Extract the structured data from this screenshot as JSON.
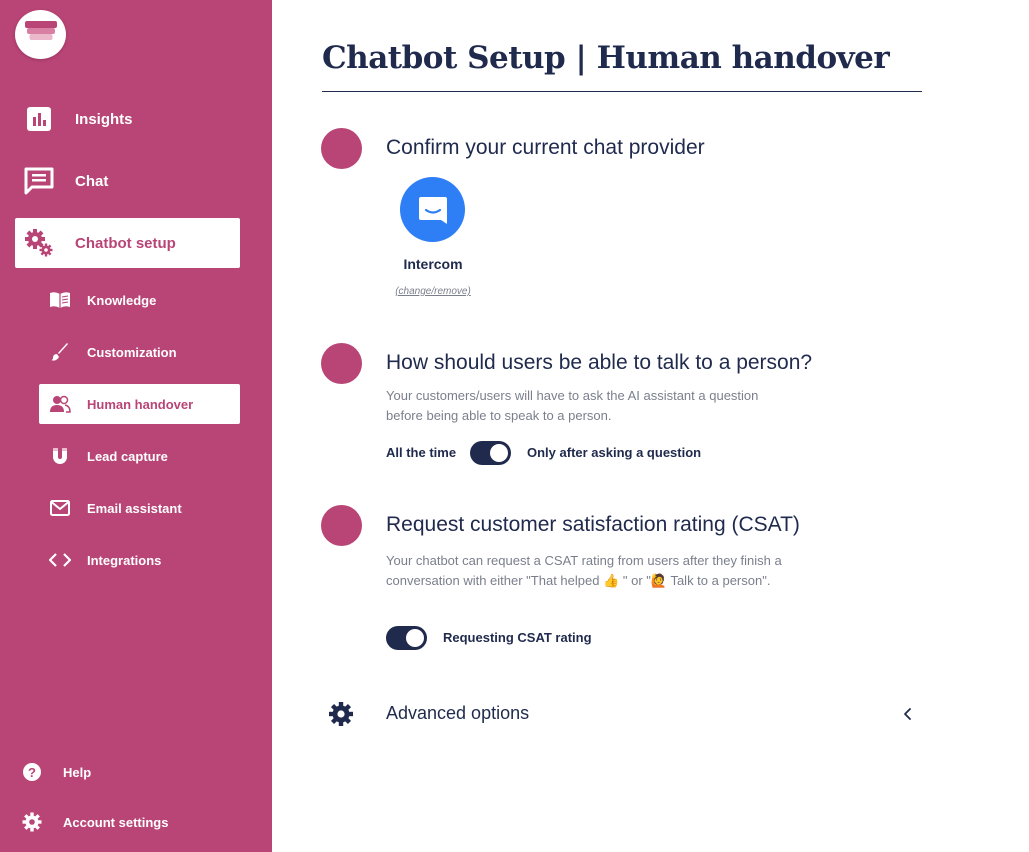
{
  "sidebar": {
    "main_items": [
      {
        "label": "Insights",
        "icon": "chart-icon"
      },
      {
        "label": "Chat",
        "icon": "chat-icon"
      },
      {
        "label": "Chatbot setup",
        "icon": "gears-icon"
      }
    ],
    "sub_items": [
      {
        "label": "Knowledge",
        "icon": "book-icon"
      },
      {
        "label": "Customization",
        "icon": "brush-icon"
      },
      {
        "label": "Human handover",
        "icon": "people-icon"
      },
      {
        "label": "Lead capture",
        "icon": "magnet-icon"
      },
      {
        "label": "Email assistant",
        "icon": "envelope-icon"
      },
      {
        "label": "Integrations",
        "icon": "code-icon"
      }
    ],
    "footer_items": [
      {
        "label": "Help",
        "icon": "help-icon"
      },
      {
        "label": "Account settings",
        "icon": "gear-icon"
      }
    ],
    "colors": {
      "background": "#b94476",
      "active_text": "#b94476"
    }
  },
  "main": {
    "title": "Chatbot Setup | Human handover",
    "sections": {
      "provider": {
        "title": "Confirm your current chat provider",
        "provider_name": "Intercom",
        "provider_icon": "intercom-icon",
        "change_link": "(change/remove)"
      },
      "talk": {
        "title": "How should users be able to talk to a person?",
        "description": "Your customers/users will have to ask the AI assistant a question before being able to speak to a person.",
        "left_label": "All the time",
        "right_label": "Only after asking a question",
        "toggle_on": true
      },
      "csat": {
        "title": "Request customer satisfaction rating (CSAT)",
        "description": "Your chatbot can request a CSAT rating from users after they finish a conversation with either \"That helped 👍 \" or \"🙋  Talk to a person\".",
        "toggle_label": "Requesting CSAT rating",
        "toggle_on": true
      }
    },
    "advanced": {
      "label": "Advanced options",
      "icon": "gear-icon",
      "chevron": "chevron-left-icon"
    },
    "colors": {
      "accent": "#b94476",
      "navy": "#1f2a4d",
      "intercom": "#2e7ef5"
    }
  }
}
